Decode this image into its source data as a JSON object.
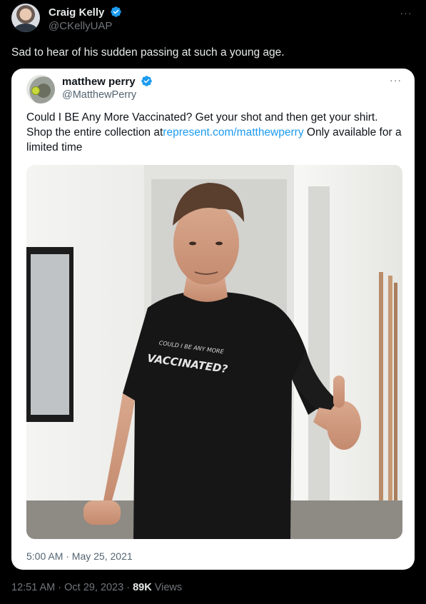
{
  "author": {
    "name": "Craig Kelly",
    "handle": "@CKellyUAP"
  },
  "tweet_text": "Sad to hear of his sudden passing at such a young age.",
  "quoted": {
    "name": "matthew perry",
    "handle": "@MatthewPerry",
    "text_before_link": "Could I BE Any More Vaccinated? Get your shot and then get your shirt. Shop the entire collection at",
    "link": "represent.com/matthewperry",
    "text_after_link": "Only available for a limited time",
    "shirt_text_line1": "COULD I BE ANY MORE",
    "shirt_text_line2": "VACCINATED?",
    "date": "5:00 AM · May 25, 2021"
  },
  "footer": {
    "time": "12:51 AM · Oct 29, 2023 · ",
    "views_count": "89K",
    "views_label": "Views"
  },
  "colors": {
    "background": "#000000",
    "verified_badge": "#1d9bf0",
    "link": "#1d9bf0"
  },
  "icons": [
    "verified-badge-icon",
    "more-options-icon"
  ]
}
